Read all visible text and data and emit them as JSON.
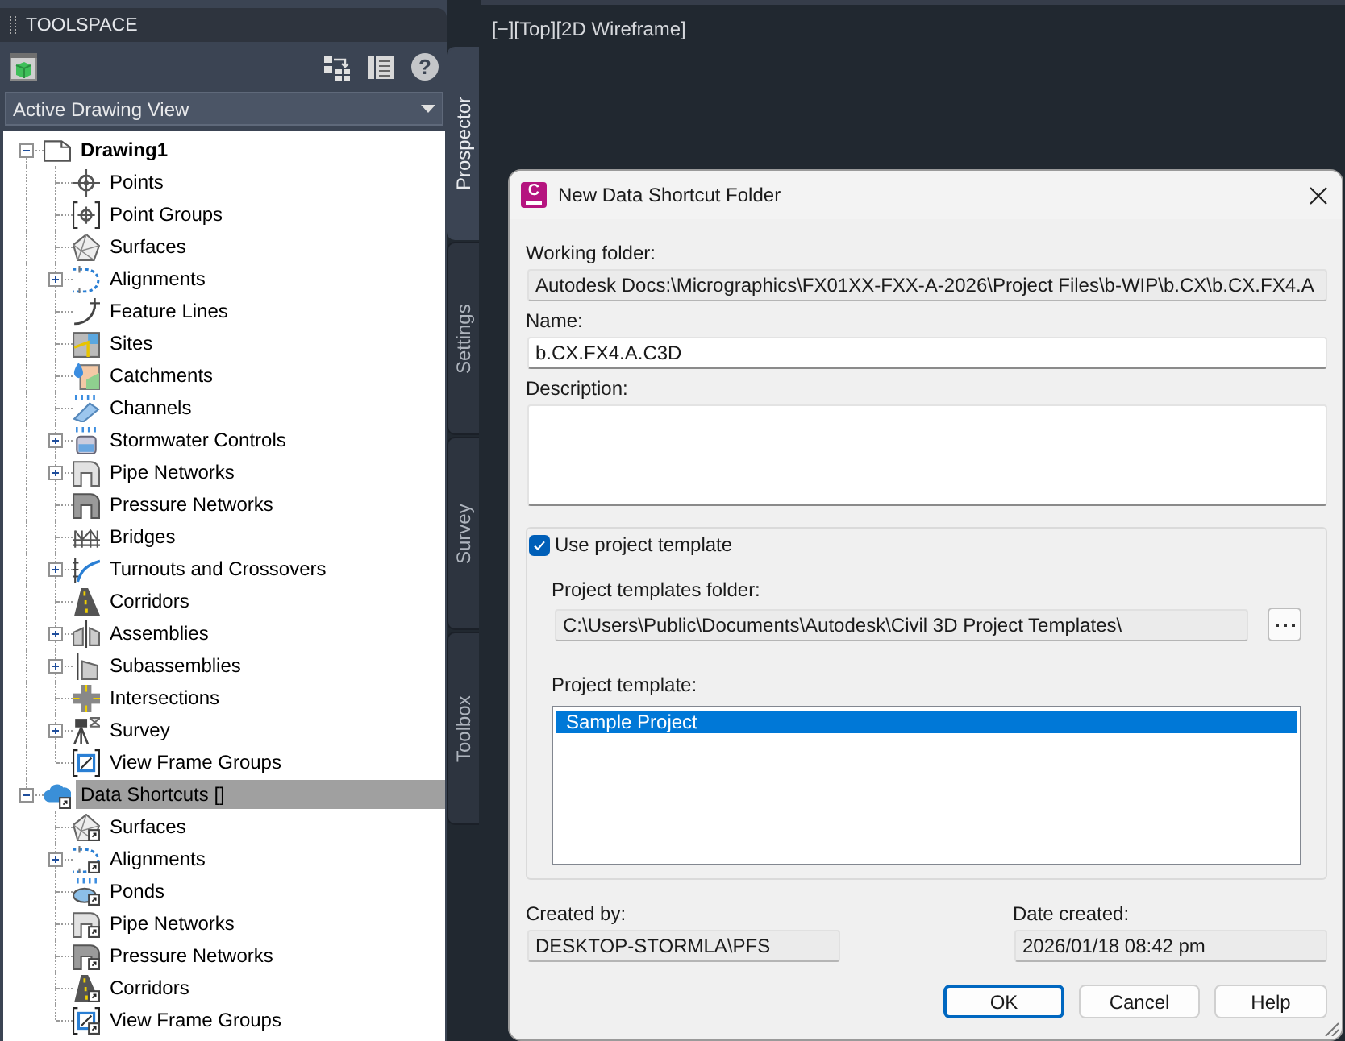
{
  "toolspace": {
    "title": "TOOLSPACE",
    "help_button": "?",
    "view_dropdown": {
      "value": "Active Drawing View"
    },
    "tree": [
      {
        "label": "Drawing1",
        "active": true,
        "expanded": true,
        "selected": false,
        "children": [
          {
            "label": "Points",
            "selected": false
          },
          {
            "label": "Point Groups",
            "selected": false
          },
          {
            "label": "Surfaces",
            "selected": false
          },
          {
            "label": "Alignments",
            "expanded": false,
            "selected": false
          },
          {
            "label": "Feature Lines",
            "selected": false
          },
          {
            "label": "Sites",
            "selected": false
          },
          {
            "label": "Catchments",
            "selected": false
          },
          {
            "label": "Channels",
            "selected": false
          },
          {
            "label": "Stormwater Controls",
            "expanded": false,
            "selected": false
          },
          {
            "label": "Pipe Networks",
            "expanded": false,
            "selected": false
          },
          {
            "label": "Pressure Networks",
            "selected": false
          },
          {
            "label": "Bridges",
            "selected": false
          },
          {
            "label": "Turnouts and Crossovers",
            "expanded": false,
            "selected": false
          },
          {
            "label": "Corridors",
            "selected": false
          },
          {
            "label": "Assemblies",
            "expanded": false,
            "selected": false
          },
          {
            "label": "Subassemblies",
            "expanded": false,
            "selected": false
          },
          {
            "label": "Intersections",
            "selected": false
          },
          {
            "label": "Survey",
            "expanded": false,
            "selected": false
          },
          {
            "label": "View Frame Groups",
            "selected": false
          }
        ]
      },
      {
        "label": "Data Shortcuts []",
        "active": false,
        "expanded": true,
        "selected": true,
        "children": [
          {
            "label": "Surfaces",
            "selected": false
          },
          {
            "label": "Alignments",
            "expanded": false,
            "selected": false
          },
          {
            "label": "Ponds",
            "selected": false
          },
          {
            "label": "Pipe Networks",
            "selected": false
          },
          {
            "label": "Pressure Networks",
            "selected": false
          },
          {
            "label": "Corridors",
            "selected": false
          },
          {
            "label": "View Frame Groups",
            "selected": false
          }
        ]
      }
    ]
  },
  "side_tabs": [
    {
      "label": "Prospector",
      "selected": true
    },
    {
      "label": "Settings",
      "selected": false
    },
    {
      "label": "Survey",
      "selected": false
    },
    {
      "label": "Toolbox",
      "selected": false
    }
  ],
  "viewport": {
    "label": "[−][Top][2D Wireframe]"
  },
  "dialog": {
    "logo": "C",
    "title": "New Data Shortcut Folder",
    "working_folder": {
      "label": "Working folder:",
      "value": "Autodesk Docs:\\Micrographics\\FX01XX-FXX-A-2026\\Project Files\\b-WIP\\b.CX\\b.CX.FX4.A",
      "read_only": true
    },
    "name": {
      "label": "Name:",
      "value": "b.CX.FX4.A.C3D",
      "read_only": false
    },
    "description": {
      "label": "Description:",
      "read_only": false
    },
    "use_template": {
      "label": "Use project template",
      "checked": true
    },
    "templates_folder": {
      "label": "Project templates folder:",
      "value": "C:\\Users\\Public\\Documents\\Autodesk\\Civil 3D Project Templates\\",
      "read_only": true
    },
    "project_template": {
      "label": "Project template:",
      "items": [
        {
          "label": "Sample Project",
          "selected": true
        }
      ]
    },
    "created_by": {
      "label": "Created by:",
      "value": "DESKTOP-STORMLA\\PFS",
      "read_only": true
    },
    "date_created": {
      "label": "Date created:",
      "value": "2026/01/18 08:42 pm",
      "read_only": true
    },
    "buttons": [
      {
        "label": "OK",
        "default": true
      },
      {
        "label": "Cancel",
        "default": false
      },
      {
        "label": "Help",
        "default": false
      }
    ]
  }
}
